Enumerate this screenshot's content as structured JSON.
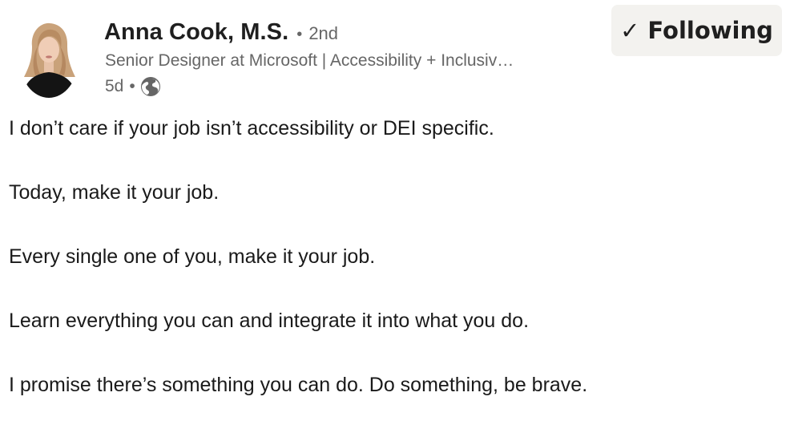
{
  "author": {
    "name": "Anna Cook, M.S.",
    "connection_degree": "2nd",
    "separator": "•",
    "headline": "Senior Designer at Microsoft | Accessibility + Inclusiv…",
    "time_ago": "5d",
    "visibility_icon": "globe-icon",
    "avatar_icon": "profile-photo"
  },
  "follow_button": {
    "check": "✓",
    "label": "Following"
  },
  "post": {
    "lines": [
      "I don’t care if your job isn’t accessibility or DEI specific.",
      "Today, make it your job.",
      "Every single one of you, make it your job.",
      "Learn everything you can and integrate it into what you do.",
      "I promise there’s something you can do. Do something, be brave."
    ]
  },
  "colors": {
    "text": "#1a1a1a",
    "muted": "#666666",
    "button_bg": "#f3f2ef"
  }
}
